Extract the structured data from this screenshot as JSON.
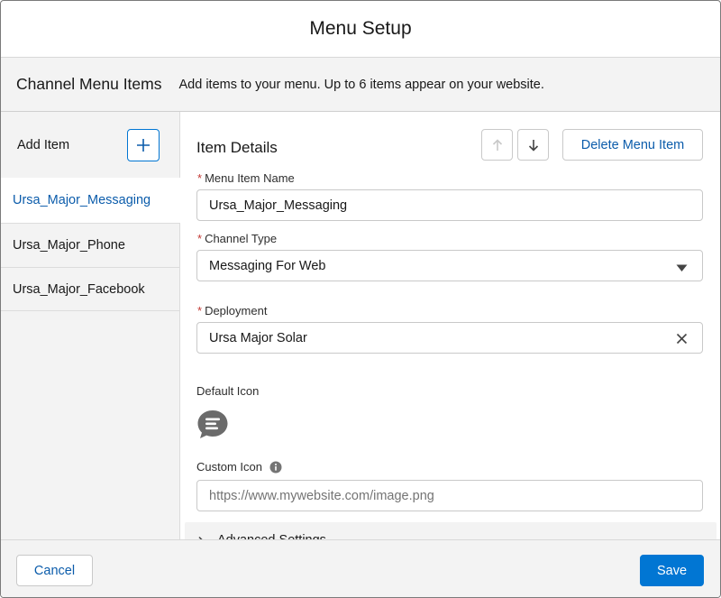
{
  "modal": {
    "title": "Menu Setup"
  },
  "subheader": {
    "title": "Channel Menu Items",
    "description": "Add items to your menu. Up to 6 items appear on your website."
  },
  "sidebar": {
    "add_label": "Add Item",
    "add_icon": "plus-icon",
    "items": [
      {
        "label": "Ursa_Major_Messaging",
        "active": true
      },
      {
        "label": "Ursa_Major_Phone",
        "active": false
      },
      {
        "label": "Ursa_Major_Facebook",
        "active": false
      }
    ]
  },
  "details": {
    "title": "Item Details",
    "move_up_icon": "arrow-up-icon",
    "move_down_icon": "arrow-down-icon",
    "delete_label": "Delete Menu Item",
    "required_marker": "*",
    "menu_item_name": {
      "label": "Menu Item Name",
      "value": "Ursa_Major_Messaging"
    },
    "channel_type": {
      "label": "Channel Type",
      "value": "Messaging For Web"
    },
    "deployment": {
      "label": "Deployment",
      "value": "Ursa Major Solar"
    },
    "default_icon": {
      "label": "Default Icon",
      "icon": "chat-bubble-icon"
    },
    "custom_icon": {
      "label": "Custom Icon",
      "placeholder": "https://www.mywebsite.com/image.png"
    },
    "advanced": {
      "label": "Advanced Settings"
    }
  },
  "footer": {
    "cancel_label": "Cancel",
    "save_label": "Save"
  },
  "colors": {
    "brand": "#0176d3",
    "link": "#0b5cab",
    "required": "#c23934",
    "panel_bg": "#f3f3f3"
  }
}
